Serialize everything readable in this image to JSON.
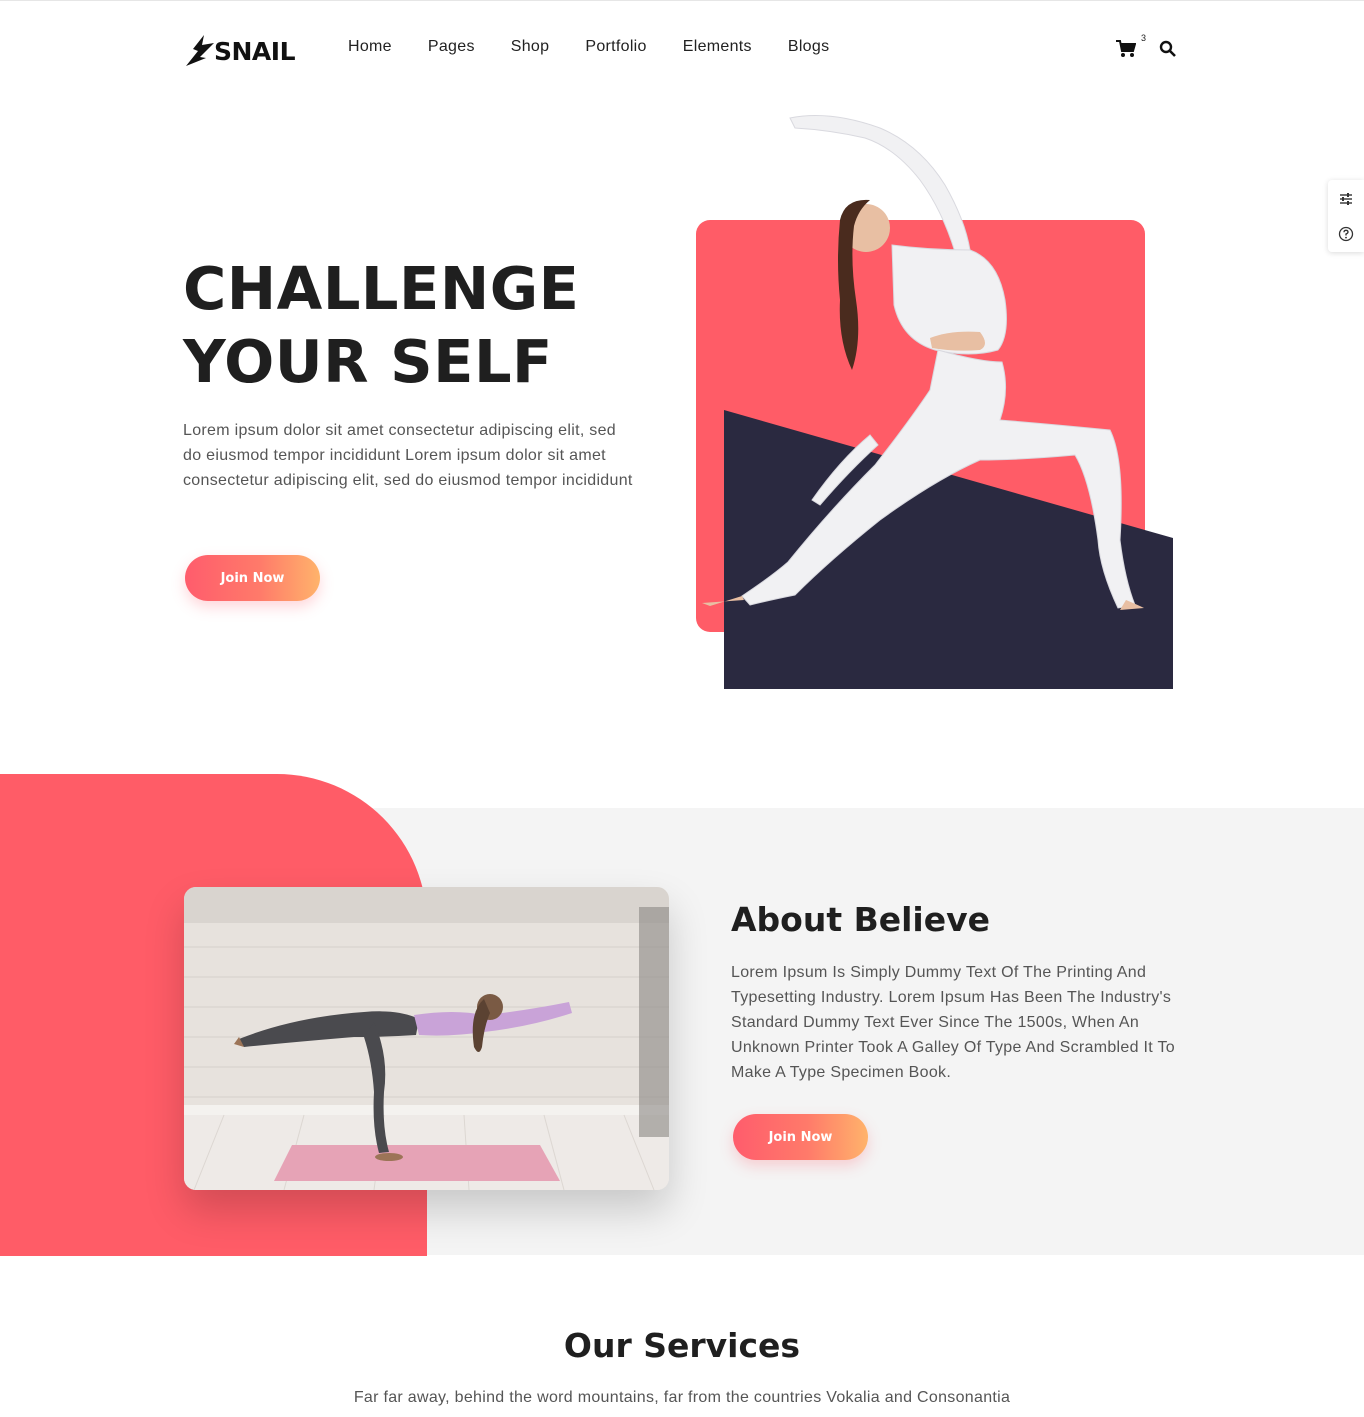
{
  "header": {
    "logo_text": "SNAIL",
    "nav": [
      "Home",
      "Pages",
      "Shop",
      "Portfolio",
      "Elements",
      "Blogs"
    ],
    "cart_count": "3",
    "icons": [
      "cart-icon",
      "search-icon"
    ]
  },
  "side_widget": {
    "icons": [
      "settings-sliders-icon",
      "help-icon"
    ]
  },
  "hero": {
    "title_line1": "CHALLENGE",
    "title_line2": "YOUR SELF",
    "text": "Lorem ipsum dolor sit amet consectetur adipiscing elit, sed do eiusmod tempor incididunt Lorem ipsum dolor sit amet consectetur adipiscing elit, sed do eiusmod tempor incididunt",
    "button": "Join Now"
  },
  "about": {
    "title": "About Believe",
    "text": "Lorem Ipsum Is Simply Dummy Text Of The Printing And Typesetting Industry. Lorem Ipsum Has Been The Industry's Standard Dummy Text Ever Since The 1500s, When An Unknown Printer Took A Galley Of Type And Scrambled It To Make A Type Specimen Book.",
    "button": "Join Now"
  },
  "services": {
    "title": "Our Services",
    "subtitle": "Far far away, behind the word mountains, far from the countries Vokalia and Consonantia"
  },
  "colors": {
    "accent": "#ff5c67",
    "accent_end": "#ffb36b",
    "navy": "#2a2940",
    "section_bg": "#f4f4f4"
  }
}
